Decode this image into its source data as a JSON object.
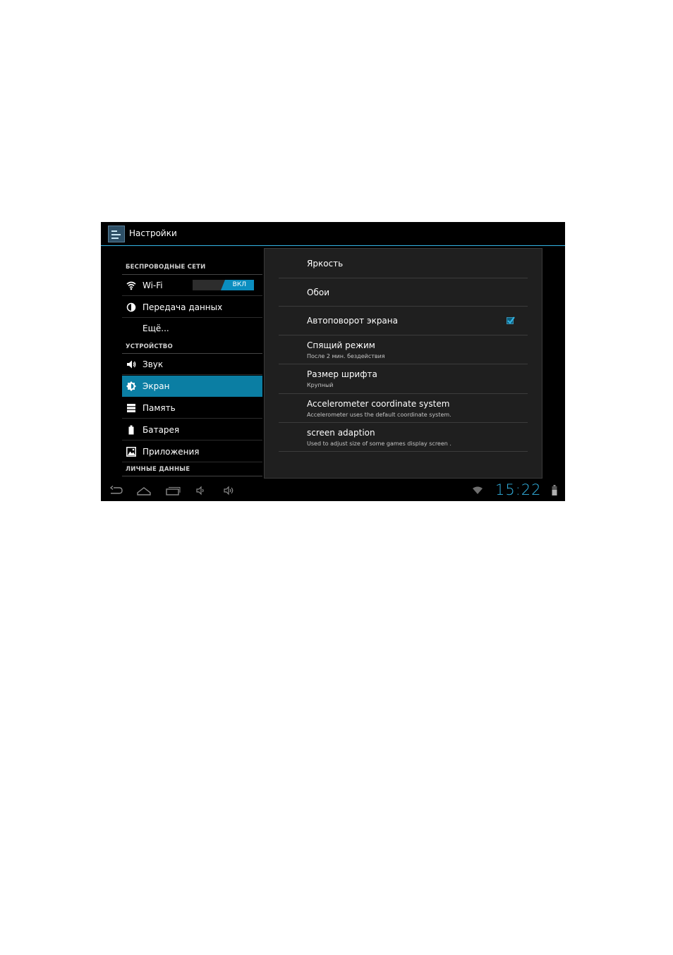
{
  "app": {
    "title": "Настройки"
  },
  "sidebar": {
    "headers": [
      "БЕСПРОВОДНЫЕ СЕТИ",
      "УСТРОЙСТВО",
      "ЛИЧНЫЕ ДАННЫЕ"
    ],
    "items": [
      {
        "label": "Wi-Fi",
        "icon": "wifi-icon",
        "toggle": "ВКЛ"
      },
      {
        "label": "Передача данных",
        "icon": "data-usage-icon"
      },
      {
        "label": "Ещё...",
        "icon": ""
      },
      {
        "label": "Звук",
        "icon": "speaker-icon"
      },
      {
        "label": "Экран",
        "icon": "brightness-icon",
        "selected": true
      },
      {
        "label": "Память",
        "icon": "storage-icon"
      },
      {
        "label": "Батарея",
        "icon": "battery-icon"
      },
      {
        "label": "Приложения",
        "icon": "apps-icon"
      }
    ]
  },
  "display_settings": [
    {
      "title": "Яркость"
    },
    {
      "title": "Обои"
    },
    {
      "title": "Автоповорот экрана",
      "checked": true
    },
    {
      "title": "Спящий режим",
      "summary": "После 2 мин. бездействия"
    },
    {
      "title": "Размер шрифта",
      "summary": "Крупный"
    },
    {
      "title": "Accelerometer coordinate system",
      "summary": "Accelerometer uses the default coordinate system."
    },
    {
      "title": "screen adaption",
      "summary": "Used to adjust size of some games display screen ."
    }
  ],
  "status": {
    "time": "15:22"
  },
  "colors": {
    "accent": "#33b5e5",
    "selected": "#0b7ea3",
    "background": "#000000",
    "panel": "#1f1f1f"
  }
}
